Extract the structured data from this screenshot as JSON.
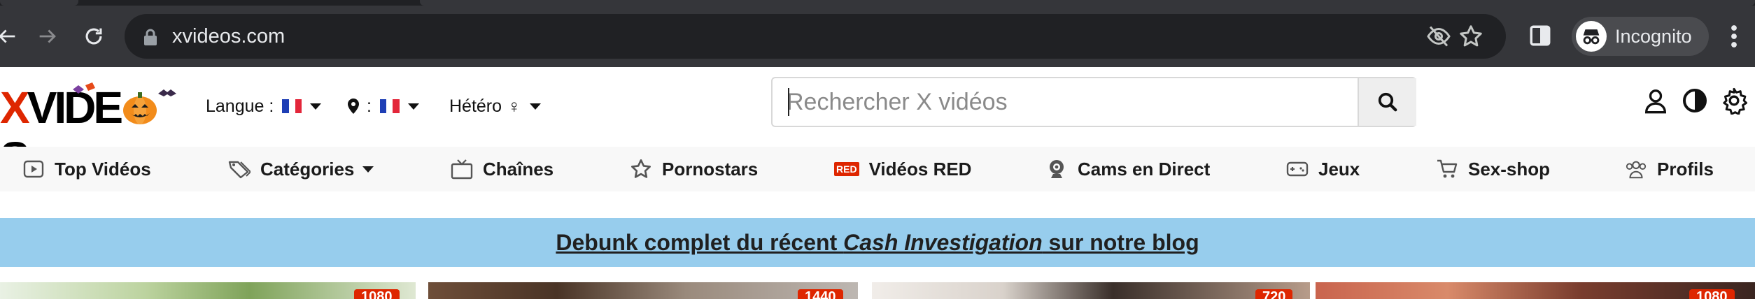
{
  "browser": {
    "url": "xvideos.com",
    "profile_label": "Incognito"
  },
  "header": {
    "logo_text_x": "X",
    "logo_text_rest": "VIDE",
    "logo_text_end": "S",
    "language_label": "Langue :",
    "country_label": ":",
    "orientation_label": "Hétéro",
    "orientation_symbol": "♀",
    "search_placeholder": "Rechercher X vidéos"
  },
  "nav": {
    "items": [
      {
        "label": "Top Vidéos",
        "icon": "play-icon"
      },
      {
        "label": "Catégories",
        "icon": "tags-icon",
        "dropdown": true
      },
      {
        "label": "Chaînes",
        "icon": "tv-icon"
      },
      {
        "label": "Pornostars",
        "icon": "star-icon"
      },
      {
        "label": "Vidéos RED",
        "icon": "red-badge",
        "badge": "RED"
      },
      {
        "label": "Cams en Direct",
        "icon": "webcam-icon"
      },
      {
        "label": "Jeux",
        "icon": "gamepad-icon"
      },
      {
        "label": "Sex-shop",
        "icon": "cart-icon"
      },
      {
        "label": "Profils",
        "icon": "users-icon"
      }
    ]
  },
  "banner": {
    "text_before": "Debunk complet du récent ",
    "text_italic": "Cash Investigation",
    "text_after": " sur notre blog"
  },
  "thumbnails": [
    {
      "count": "1080"
    },
    {
      "count": "1440"
    },
    {
      "count": "720"
    },
    {
      "count": "1080"
    }
  ],
  "colors": {
    "brand_red": "#de2600",
    "banner_blue": "#97cded",
    "chrome_dark": "#35363a",
    "omnibox": "#202124"
  }
}
